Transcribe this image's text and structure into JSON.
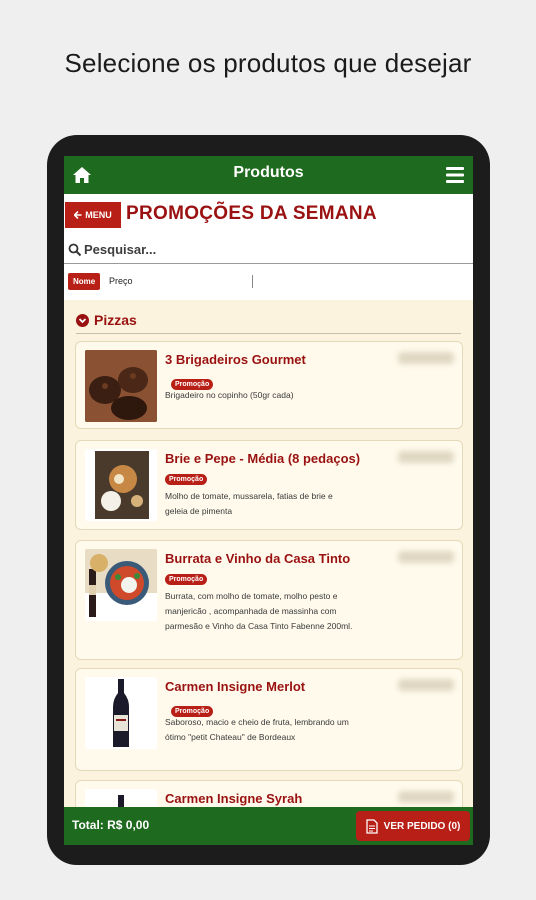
{
  "caption": "Selecione os produtos que desejar",
  "header": {
    "title": "Produtos"
  },
  "menu_button": "MENU",
  "page_title": "PROMOÇÕES DA SEMANA",
  "search": {
    "placeholder": "Pesquisar..."
  },
  "sort": {
    "active": "Nome",
    "other": "Preço"
  },
  "section": {
    "title": "Pizzas"
  },
  "badge_label": "Promoção",
  "products": [
    {
      "name": "3 Brigadeiros Gourmet",
      "description": "Brigadeiro no copinho (50gr cada)"
    },
    {
      "name": "Brie e Pepe - Média (8 pedaços)",
      "description": "Molho de tomate, mussarela, fatias de brie e geleia de pimenta"
    },
    {
      "name": "Burrata e Vinho da Casa Tinto",
      "description": "Burrata, com molho de tomate, molho pesto e manjericão , acompanhada de massinha com parmesão e Vinho da Casa Tinto Fabenne 200ml."
    },
    {
      "name": "Carmen Insigne Merlot",
      "description": "Saboroso, macio e cheio de fruta, lembrando um ótimo \"petit Chateau\" de Bordeaux"
    },
    {
      "name": "Carmen Insigne Syrah",
      "description": ""
    }
  ],
  "footer": {
    "total": "Total: R$ 0,00",
    "order_button": "VER PEDIDO (0)"
  },
  "colors": {
    "green": "#1e6a1e",
    "red": "#b81f16",
    "dark_red": "#9a1111",
    "cream": "#fbf3dd"
  }
}
